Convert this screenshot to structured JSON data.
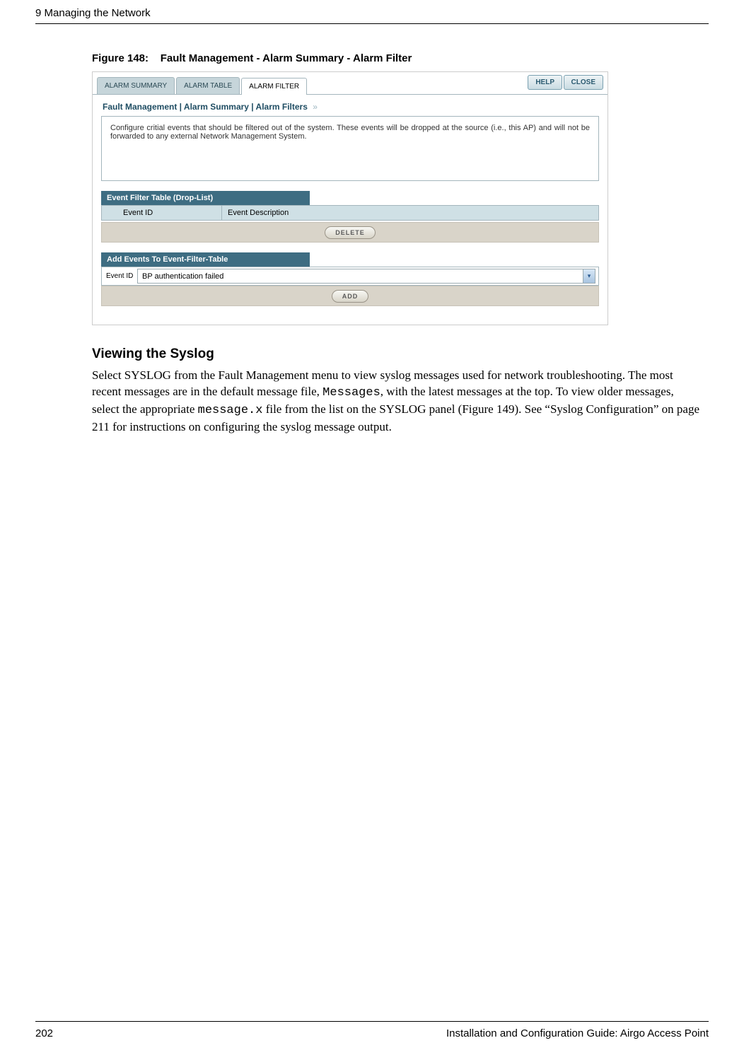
{
  "header": {
    "chapter": "9  Managing the Network"
  },
  "figure": {
    "caption_prefix": "Figure 148:",
    "caption_title": "Fault Management - Alarm Summary - Alarm Filter"
  },
  "screenshot": {
    "tabs": {
      "summary": "ALARM SUMMARY",
      "table": "ALARM TABLE",
      "filter": "ALARM FILTER"
    },
    "buttons": {
      "help": "HELP",
      "close": "CLOSE"
    },
    "breadcrumb": "Fault Management | Alarm Summary | Alarm Filters",
    "intro": "Configure critial events that should be filtered out of the system. These events will be dropped at the source (i.e., this AP) and will not be forwarded to any external Network Management System.",
    "filter_table": {
      "title": "Event Filter Table (Drop-List)",
      "col1": "Event ID",
      "col2": "Event Description",
      "delete_label": "DELETE"
    },
    "add_section": {
      "title": "Add Events To Event-Filter-Table",
      "label": "Event ID",
      "selected": "BP authentication failed",
      "add_label": "ADD"
    }
  },
  "section": {
    "heading": "Viewing the Syslog",
    "p1a": "Select SYSLOG from the Fault Management menu to view syslog messages used for network troubleshooting. The most recent messages are in the default message file, ",
    "p1_code1": "Messages",
    "p1b": ", with the latest messages at the top. To view older messages, select the appropriate ",
    "p1_code2": "message.x",
    "p1c": " file from the list on the SYSLOG panel (Figure 149). See “Syslog Configuration” on page 211 for instructions on configuring the syslog message output."
  },
  "footer": {
    "page": "202",
    "title": "Installation and Configuration Guide: Airgo Access Point"
  }
}
